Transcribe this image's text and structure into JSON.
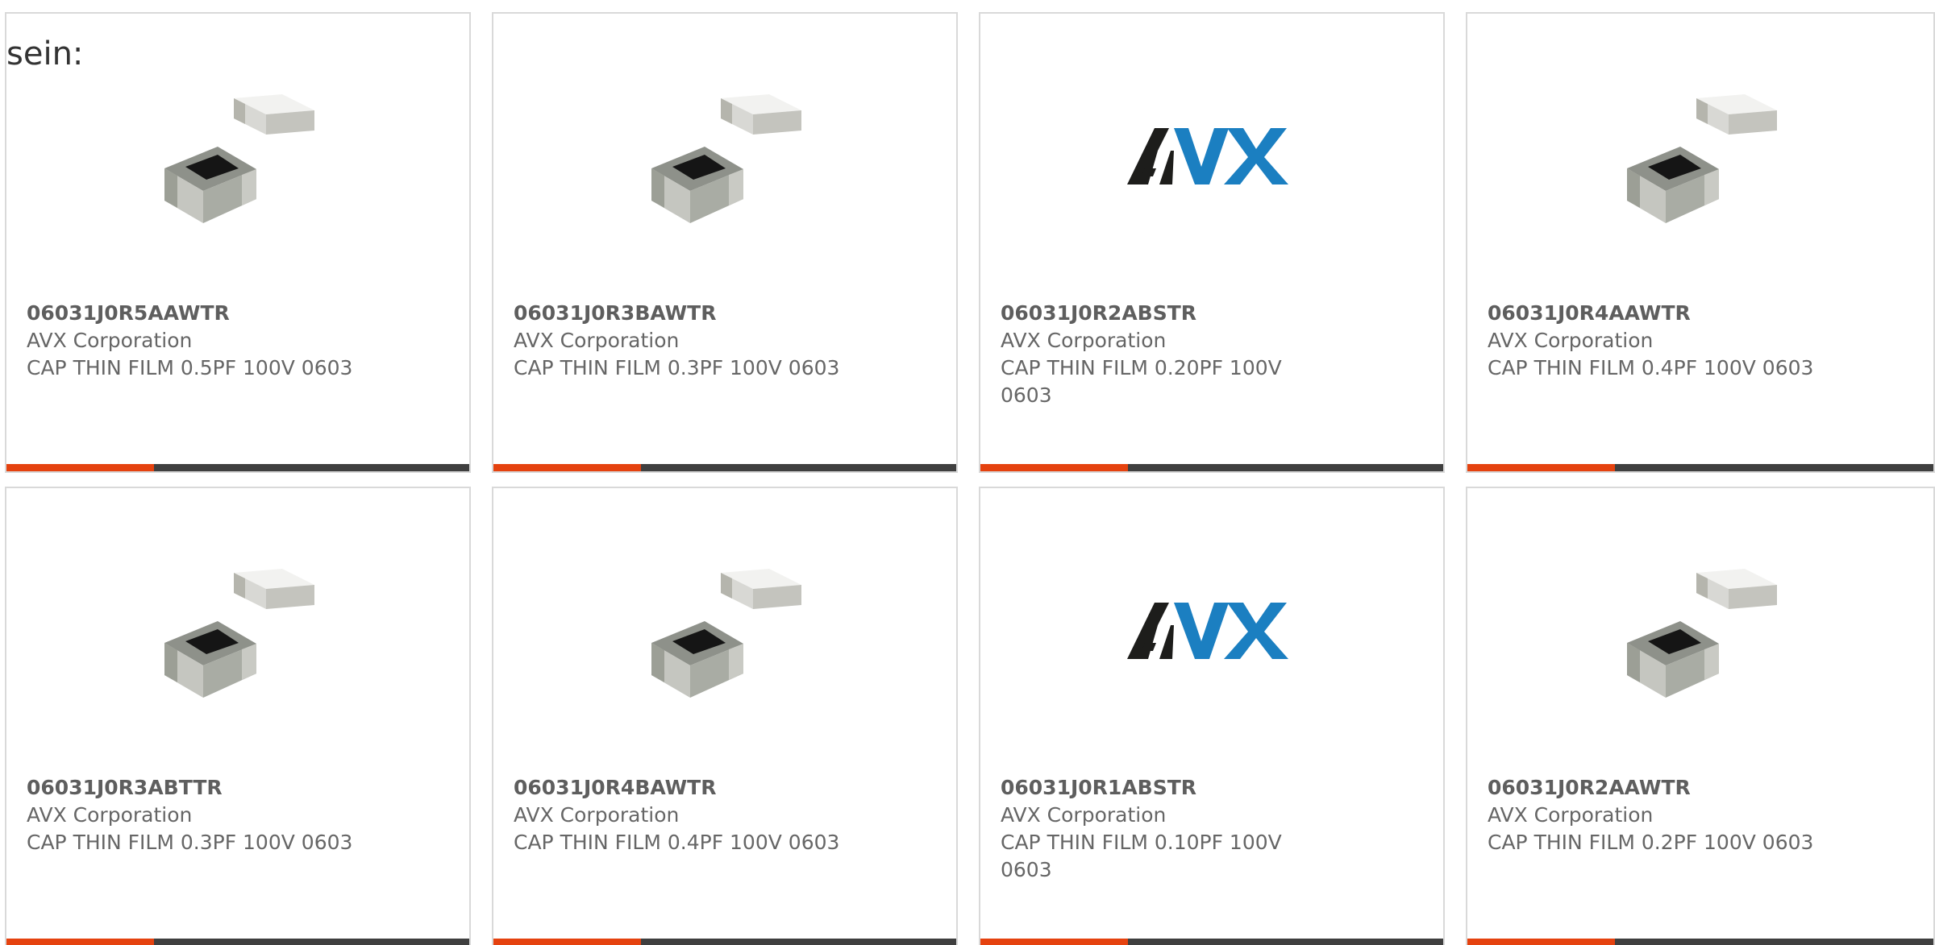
{
  "corner_text": "sein:",
  "brand_colors": {
    "accent": "#e5420f",
    "bar": "#3f3f3f",
    "avx_dark": "#1d1d1b",
    "avx_blue": "#1b7fc1"
  },
  "cards": [
    {
      "image": "capacitor-chip-image",
      "part": "06031J0R5AAWTR",
      "maker": "AVX Corporation",
      "desc": "CAP THIN FILM 0.5PF 100V 0603"
    },
    {
      "image": "capacitor-chip-image",
      "part": "06031J0R3BAWTR",
      "maker": "AVX Corporation",
      "desc": "CAP THIN FILM 0.3PF 100V 0603"
    },
    {
      "image": "avx-logo",
      "logo_text": "AVX",
      "part": "06031J0R2ABSTR",
      "maker": "AVX Corporation",
      "desc": "CAP THIN FILM 0.20PF 100V 0603"
    },
    {
      "image": "capacitor-chip-image",
      "part": "06031J0R4AAWTR",
      "maker": "AVX Corporation",
      "desc": "CAP THIN FILM 0.4PF 100V 0603"
    },
    {
      "image": "capacitor-chip-image",
      "part": "06031J0R3ABTTR",
      "maker": "AVX Corporation",
      "desc": "CAP THIN FILM 0.3PF 100V 0603"
    },
    {
      "image": "capacitor-chip-image",
      "part": "06031J0R4BAWTR",
      "maker": "AVX Corporation",
      "desc": "CAP THIN FILM 0.4PF 100V 0603"
    },
    {
      "image": "avx-logo",
      "logo_text": "AVX",
      "part": "06031J0R1ABSTR",
      "maker": "AVX Corporation",
      "desc": "CAP THIN FILM 0.10PF 100V 0603"
    },
    {
      "image": "capacitor-chip-image",
      "part": "06031J0R2AAWTR",
      "maker": "AVX Corporation",
      "desc": "CAP THIN FILM 0.2PF 100V 0603"
    }
  ]
}
